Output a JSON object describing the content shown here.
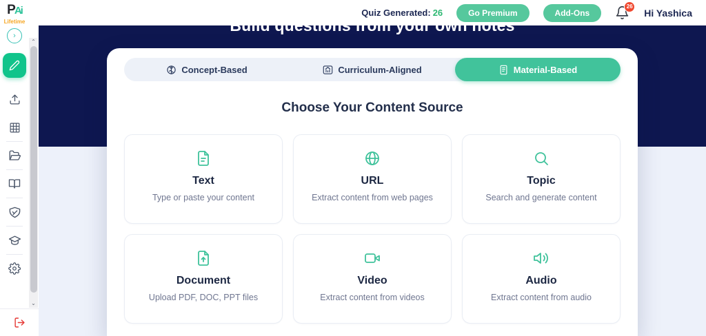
{
  "colors": {
    "accent_green": "#3fc29b",
    "navy": "#0e1750",
    "badge_red": "#f0482f",
    "plan_orange": "#f5a623"
  },
  "sidebar": {
    "logo_text_dark": "P",
    "logo_text_green": "Ai",
    "plan_badge": "Lifetime",
    "chevron": "›",
    "icons": [
      "pencil-icon",
      "upload-icon",
      "grid-icon",
      "folder-icon",
      "book-icon",
      "handshake-icon",
      "graduation-cap-icon",
      "gear-icon",
      "logout-icon"
    ],
    "scroll_up": "⌃",
    "scroll_down": "⌄"
  },
  "header": {
    "quiz_generated_label": "Quiz Generated:",
    "quiz_generated_count": "26",
    "go_premium_label": "Go Premium",
    "addons_label": "Add-Ons",
    "notification_count": "26",
    "greeting": "Hi Yashica"
  },
  "hero": {
    "title": "Build questions from your own notes"
  },
  "content": {
    "tabs": [
      {
        "label": "Concept-Based",
        "icon": "brain-icon",
        "active": false
      },
      {
        "label": "Curriculum-Aligned",
        "icon": "school-icon",
        "active": false
      },
      {
        "label": "Material-Based",
        "icon": "material-icon",
        "active": true
      }
    ],
    "heading": "Choose Your Content Source",
    "sources": [
      {
        "icon": "text-icon",
        "title": "Text",
        "description": "Type or paste your content"
      },
      {
        "icon": "url-icon",
        "title": "URL",
        "description": "Extract content from web pages"
      },
      {
        "icon": "topic-icon",
        "title": "Topic",
        "description": "Search and generate content"
      },
      {
        "icon": "document-icon",
        "title": "Document",
        "description": "Upload PDF, DOC, PPT files"
      },
      {
        "icon": "video-icon",
        "title": "Video",
        "description": "Extract content from videos"
      },
      {
        "icon": "audio-icon",
        "title": "Audio",
        "description": "Extract content from audio"
      }
    ]
  }
}
